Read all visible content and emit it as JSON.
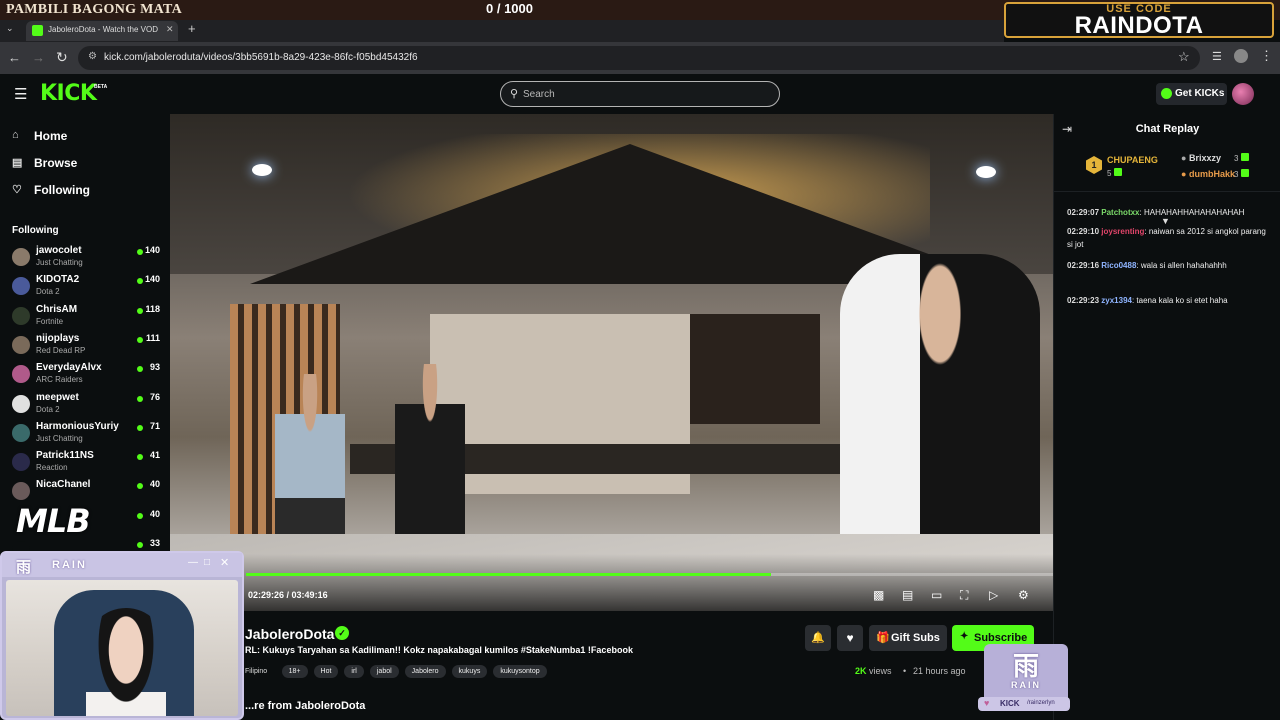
{
  "overlay": {
    "title": "PAMBILI BAGONG MATA",
    "counter": "0 / 1000",
    "code_small": "USE CODE",
    "code_big": "RAINDOTA",
    "mlb": "MLB",
    "rain_mark": "雨",
    "rain_word": "RAIN",
    "kick_handle_brand": "KICK",
    "kick_handle_text": "/rainzerlyn"
  },
  "browser": {
    "tab_title": "JaboleroDota - Watch the VOD",
    "url": "kick.com/jaboleroduta/videos/3bb5691b-8a29-423e-86fc-f05bd45432f6"
  },
  "header": {
    "logo": "KICK",
    "beta": "BETA",
    "search_placeholder": "Search",
    "get_kicks": "Get KICKs"
  },
  "sidebar": {
    "nav": [
      {
        "label": "Home",
        "icon": "home-icon"
      },
      {
        "label": "Browse",
        "icon": "browse-icon"
      },
      {
        "label": "Following",
        "icon": "heart-icon"
      }
    ],
    "following_heading": "Following",
    "channels": [
      {
        "name": "jawocolet",
        "category": "Just Chatting",
        "viewers": "140",
        "color": "#8a7a6a"
      },
      {
        "name": "KIDOTA2",
        "category": "Dota 2",
        "viewers": "140",
        "color": "#4a5a9a"
      },
      {
        "name": "ChrisAM",
        "category": "Fortnite",
        "viewers": "118",
        "color": "#2e3a2a"
      },
      {
        "name": "nijoplays",
        "category": "Red Dead RP",
        "viewers": "111",
        "color": "#7a6a5a"
      },
      {
        "name": "EverydayAlvx",
        "category": "ARC Raiders",
        "viewers": "93",
        "color": "#b05a8a"
      },
      {
        "name": "meepwet",
        "category": "Dota 2",
        "viewers": "76",
        "color": "#e0e0e0"
      },
      {
        "name": "HarmoniousYuriy",
        "category": "Just Chatting",
        "viewers": "71",
        "color": "#3a6a6a"
      },
      {
        "name": "Patrick11NS",
        "category": "Reaction",
        "viewers": "41",
        "color": "#2a2a4a"
      },
      {
        "name": "NicaChanel",
        "category": "",
        "viewers": "40",
        "color": "#6a5a5a"
      },
      {
        "name": "",
        "category": "",
        "viewers": "40",
        "color": "#0b0e0f"
      },
      {
        "name": "",
        "category": "",
        "viewers": "33",
        "color": "#0b0e0f"
      }
    ]
  },
  "player": {
    "current_time": "02:29:26",
    "duration": "03:49:16",
    "progress_fraction": 0.6505
  },
  "video": {
    "channel": "JaboleroDota",
    "title": "RL: Kukuys Taryahan sa Kadiliman!! Kokz napakabagal kumilos #StakeNumba1 !Facebook",
    "language": "Filipino",
    "tags": [
      "18+",
      "Hot",
      "irl",
      "jabol",
      "Jabolero",
      "kukuys",
      "kukuysontop"
    ],
    "gift_subs": "Gift Subs",
    "subscribe": "Subscribe",
    "views_num": "2K",
    "views_word": "views",
    "age": "21 hours ago",
    "more_from": "...re from JaboleroDota"
  },
  "chat": {
    "title": "Chat Replay",
    "leaderboard": [
      {
        "rank": "1",
        "name": "CHUPAENG",
        "count": "5"
      },
      {
        "name": "Brixxzy",
        "count": "3"
      },
      {
        "name": "dumbHakk",
        "count": "3"
      }
    ],
    "messages": [
      {
        "time": "02:29:07",
        "user": "Patchotxx",
        "user_color": "#7bd96a",
        "text": "HAHAHAHHAHAHAHAHAH"
      },
      {
        "time": "02:29:10",
        "user": "joysrenting",
        "user_color": "#e2456a",
        "text": "naiwan sa 2012 si angkol parang si jot"
      },
      {
        "time": "02:29:16",
        "user": "Rico0488",
        "user_color": "#8fb4ff",
        "text": "wala si allen hahahahhh"
      },
      {
        "time": "02:29:23",
        "user": "zyx1394",
        "user_color": "#8fb4ff",
        "text": "taena kala ko si etet haha"
      }
    ]
  },
  "colors": {
    "accent": "#53fc18",
    "background": "#0b0e0f"
  }
}
